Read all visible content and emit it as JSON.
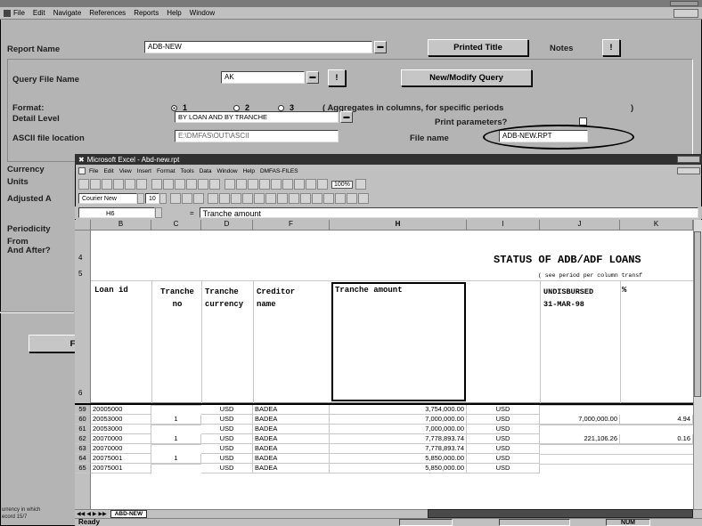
{
  "outer": {
    "menu": [
      "File",
      "Edit",
      "Navigate",
      "References",
      "Reports",
      "Help",
      "Window"
    ],
    "report_name_label": "Report Name",
    "report_name_value": "ADB-NEW",
    "printed_title_btn": "Printed Title",
    "notes_label": "Notes",
    "notes_btn": "!",
    "query_label": "Query File Name",
    "query_value": "AK",
    "query_btn": "!",
    "newmodify_btn": "New/Modify Query",
    "format_label": "Format:",
    "format_opts": [
      "1",
      "2",
      "3"
    ],
    "format_note": "( Aggregates in columns, for specific periods",
    "format_note_end": ")",
    "detail_label": "Detail Level",
    "detail_value": "BY LOAN AND BY TRANCHE",
    "print_params": "Print parameters?",
    "ascii_label": "ASCII file location",
    "ascii_value": "E:\\DMFAS\\OUT\\ASCII",
    "filename_label": "File name",
    "filename_value": "ADB-NEW.RPT",
    "left_labels": [
      "Currency",
      "Units",
      "Adjusted A",
      "Periodicity",
      "From",
      "And After?"
    ],
    "file_btn": "File",
    "status_small1": "urrency in which",
    "status_small2": "ecord 15/7",
    "status": "Ready",
    "num": "NUM"
  },
  "excel": {
    "title": "Microsoft Excel - Abd-new.rpt",
    "menu": [
      "File",
      "Edit",
      "View",
      "Insert",
      "Format",
      "Tools",
      "Data",
      "Window",
      "Help",
      "DMFAS-FILES"
    ],
    "font_name": "Courier New",
    "font_size": "10",
    "zoom": "100%",
    "name_box": "H6",
    "formula_eq": "=",
    "formula": "Tranche amount",
    "cols": [
      "B",
      "C",
      "D",
      "F",
      "H",
      "I",
      "J",
      "K"
    ],
    "title_row_num": "4",
    "note_row_num": "5",
    "header_row_num": "6",
    "sheet_title": "STATUS OF ADB/ADF LOANS",
    "sheet_note": "( see period per column   transf",
    "headers": {
      "B": "Loan id",
      "C": "Tranche\nno",
      "D": "Tranche\ncurrency",
      "F": "Creditor\nname",
      "H": "Tranche amount",
      "J": "UNDISBURSED\n31-MAR-98",
      "K": "%"
    },
    "rows": [
      {
        "n": "59",
        "b": "20005000",
        "c": "",
        "d": "USD",
        "f": "BADEA",
        "h": "3,754,000.00",
        "i": "USD",
        "j": "",
        "k": ""
      },
      {
        "n": "60",
        "b": "20053000",
        "c": "1",
        "d": "USD",
        "f": "BADEA",
        "h": "7,000,000.00",
        "i": "USD",
        "j": "7,000,000.00",
        "k": "4.94"
      },
      {
        "n": "61",
        "b": "20053000",
        "c": "",
        "d": "USD",
        "f": "BADEA",
        "h": "7,000,000.00",
        "i": "USD",
        "j": "",
        "k": ""
      },
      {
        "n": "62",
        "b": "20070000",
        "c": "1",
        "d": "USD",
        "f": "BADEA",
        "h": "7,778,893.74",
        "i": "USD",
        "j": "221,106.26",
        "k": "0.16"
      },
      {
        "n": "63",
        "b": "20070000",
        "c": "",
        "d": "USD",
        "f": "BADEA",
        "h": "7,778,893.74",
        "i": "USD",
        "j": "",
        "k": ""
      },
      {
        "n": "64",
        "b": "20075001",
        "c": "1",
        "d": "USD",
        "f": "BADEA",
        "h": "5,850,000.00",
        "i": "USD",
        "j": "",
        "k": ""
      },
      {
        "n": "65",
        "b": "20075001",
        "c": "",
        "d": "USD",
        "f": "BADEA",
        "h": "5,850,000.00",
        "i": "USD",
        "j": "",
        "k": ""
      }
    ],
    "sheet_tab": "ABD-NEW"
  }
}
